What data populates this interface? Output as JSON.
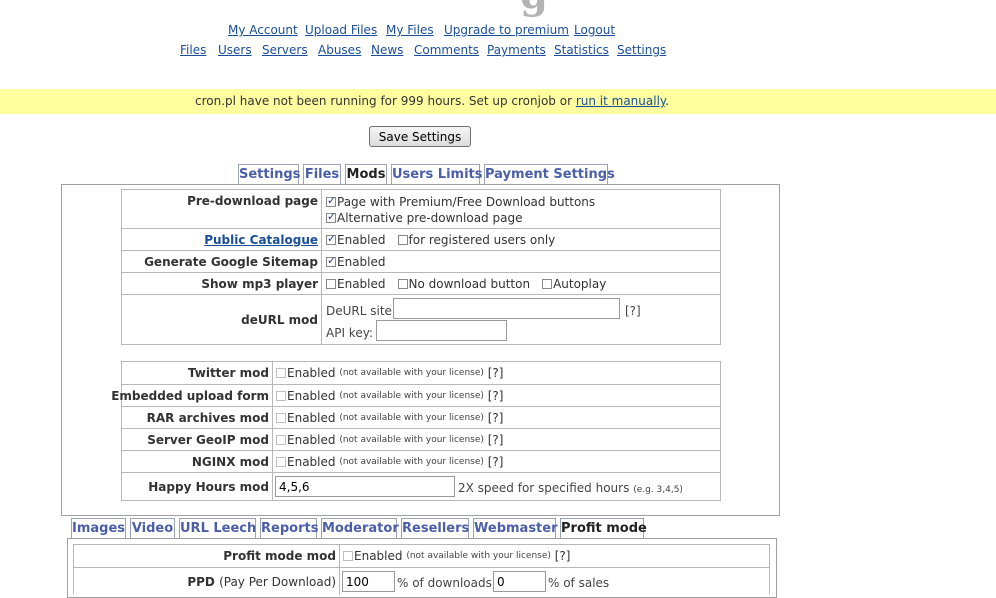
{
  "nav_user": [
    "My Account",
    "Upload Files",
    "My Files",
    "Upgrade to premium",
    "Logout"
  ],
  "nav_admin": [
    "Files",
    "Users",
    "Servers",
    "Abuses",
    "News",
    "Comments",
    "Payments",
    "Statistics",
    "Settings"
  ],
  "cron": {
    "text": "cron.pl have not been running for 999 hours. Set up cronjob or ",
    "link": "run it manually",
    "end": "."
  },
  "save_label": "Save Settings",
  "tabs_top": [
    "Settings",
    "Files",
    "Mods",
    "Users Limits",
    "Payment Settings"
  ],
  "tabs_top_active": "Mods",
  "mods": {
    "predownload_label": "Pre-download page",
    "predownload_opt1": "Page with Premium/Free Download buttons",
    "predownload_opt2": "Alternative pre-download page",
    "catalogue_label": "Public Catalogue",
    "catalogue_enabled": "Enabled",
    "catalogue_reg": "for registered users only",
    "sitemap_label": "Generate Google Sitemap",
    "sitemap_enabled": "Enabled",
    "mp3_label": "Show mp3 player",
    "mp3_enabled": "Enabled",
    "mp3_nodl": "No download button",
    "mp3_autoplay": "Autoplay",
    "deurl_label": "deURL mod",
    "deurl_site": "DeURL site:",
    "deurl_help": "[?]",
    "deurl_api": "API key:"
  },
  "license_mods": [
    {
      "label": "Twitter mod"
    },
    {
      "label": "Embedded upload form"
    },
    {
      "label": "RAR archives mod"
    },
    {
      "label": "Server GeoIP mod"
    },
    {
      "label": "NGINX mod"
    }
  ],
  "enabled_word": "Enabled",
  "not_avail": "(not available with your license)",
  "help": "[?]",
  "happy": {
    "label": "Happy Hours mod",
    "value": "4,5,6",
    "desc": "2X speed for specified hours",
    "eg": "(e.g. 3,4,5)"
  },
  "tabs_bottom": [
    "Images",
    "Video",
    "URL Leech",
    "Reports",
    "Moderator",
    "Resellers",
    "Webmaster",
    "Profit mode"
  ],
  "tabs_bottom_active": "Profit mode",
  "profit": {
    "label": "Profit mode mod",
    "enabled": "Enabled",
    "ppd_label": "PPD",
    "ppd_sub": "(Pay Per Download)",
    "ppd_value": "100",
    "ppd_pct_dl": "% of downloads,",
    "ppd_value2": "0",
    "ppd_pct_sales": "% of sales"
  }
}
